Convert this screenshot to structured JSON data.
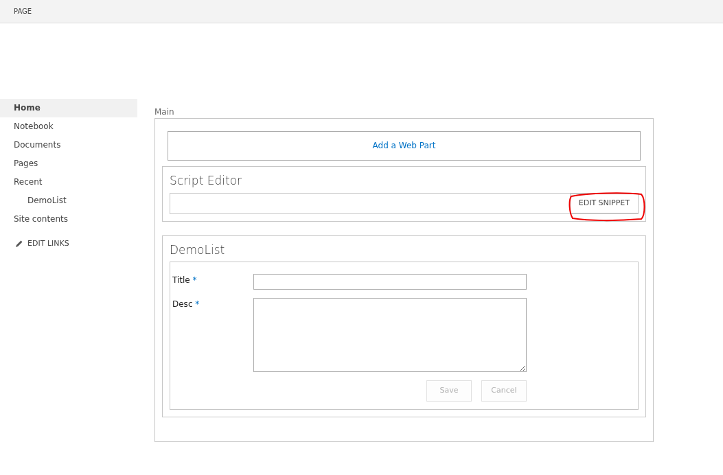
{
  "ribbon": {
    "tabs": [
      {
        "label": "PAGE",
        "selected": false
      }
    ]
  },
  "sidebar": {
    "items": [
      {
        "label": "Home",
        "selected": true
      },
      {
        "label": "Notebook",
        "selected": false
      },
      {
        "label": "Documents",
        "selected": false
      },
      {
        "label": "Pages",
        "selected": false
      },
      {
        "label": "Recent",
        "selected": false,
        "children": [
          {
            "label": "DemoList",
            "selected": false
          }
        ]
      },
      {
        "label": "Site contents",
        "selected": false
      }
    ],
    "edit_links": "EDIT LINKS"
  },
  "zone": {
    "title": "Main",
    "add_web_part": "Add a Web Part",
    "script_editor": {
      "title": "Script Editor",
      "button": {
        "label": "EDIT SNIPPET",
        "highlighted": true
      }
    },
    "list_form": {
      "title": "DemoList",
      "fields": [
        {
          "label": "Title",
          "required": "*",
          "kind": "text"
        },
        {
          "label": "Desc",
          "required": "*",
          "kind": "multiline"
        }
      ],
      "buttons": [
        {
          "label": "Save",
          "disabled": true
        },
        {
          "label": "Cancel",
          "disabled": true
        }
      ]
    }
  }
}
